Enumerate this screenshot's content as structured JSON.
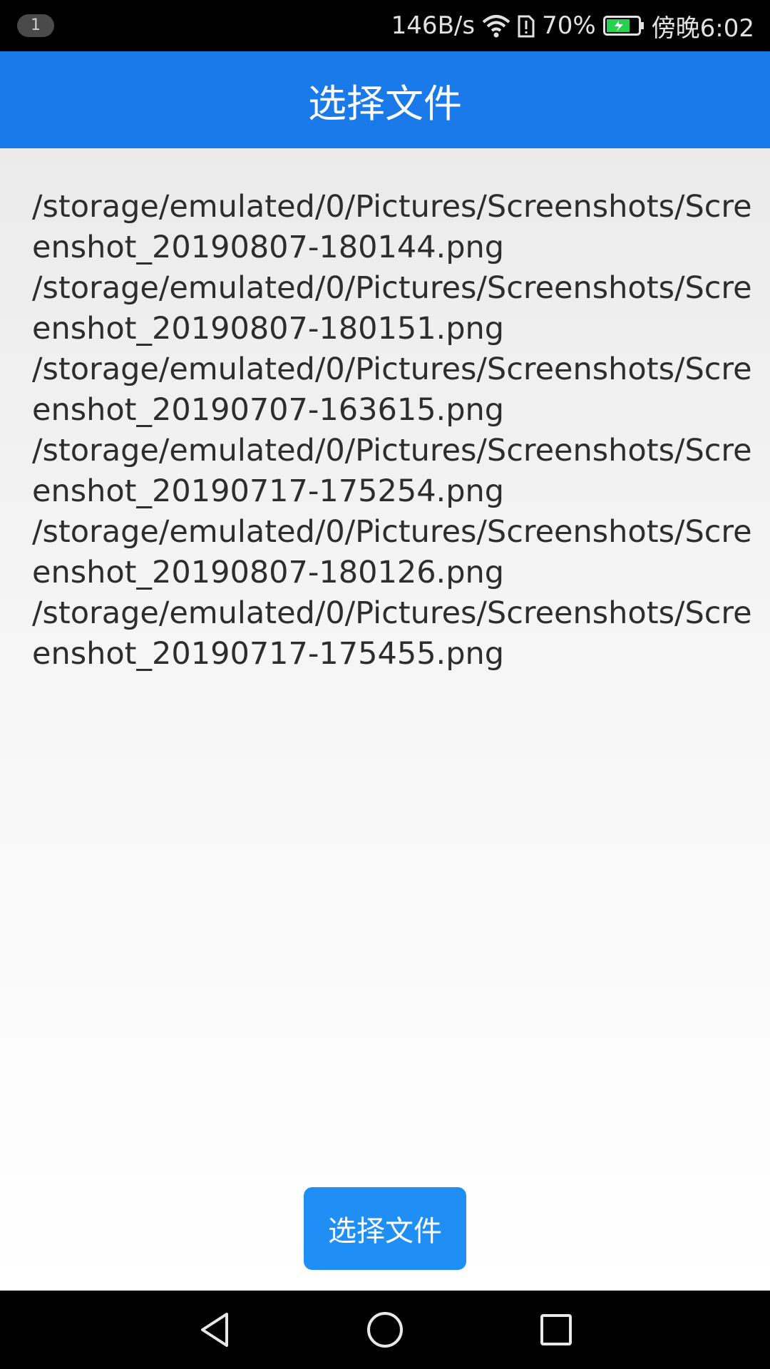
{
  "status_bar": {
    "notification_count": "1",
    "network_speed": "146B/s",
    "battery_percent": "70%",
    "time": "傍晚6:02",
    "icons": [
      "wifi-icon",
      "sim-alert-icon",
      "battery-charging-icon"
    ]
  },
  "app_bar": {
    "title": "选择文件"
  },
  "file_list": {
    "items": [
      "/storage/emulated/0/Pictures/Screenshots/Screenshot_20190807-180144.png",
      "/storage/emulated/0/Pictures/Screenshots/Screenshot_20190807-180151.png",
      "/storage/emulated/0/Pictures/Screenshots/Screenshot_20190707-163615.png",
      "/storage/emulated/0/Pictures/Screenshots/Screenshot_20190717-175254.png",
      "/storage/emulated/0/Pictures/Screenshots/Screenshot_20190807-180126.png",
      "/storage/emulated/0/Pictures/Screenshots/Screenshot_20190717-175455.png"
    ]
  },
  "actions": {
    "select_button_label": "选择文件"
  },
  "nav_bar": {
    "icons": [
      "back-icon",
      "home-icon",
      "recents-icon"
    ]
  },
  "colors": {
    "app_bar": "#1b7aea",
    "button": "#1f8ff5"
  }
}
